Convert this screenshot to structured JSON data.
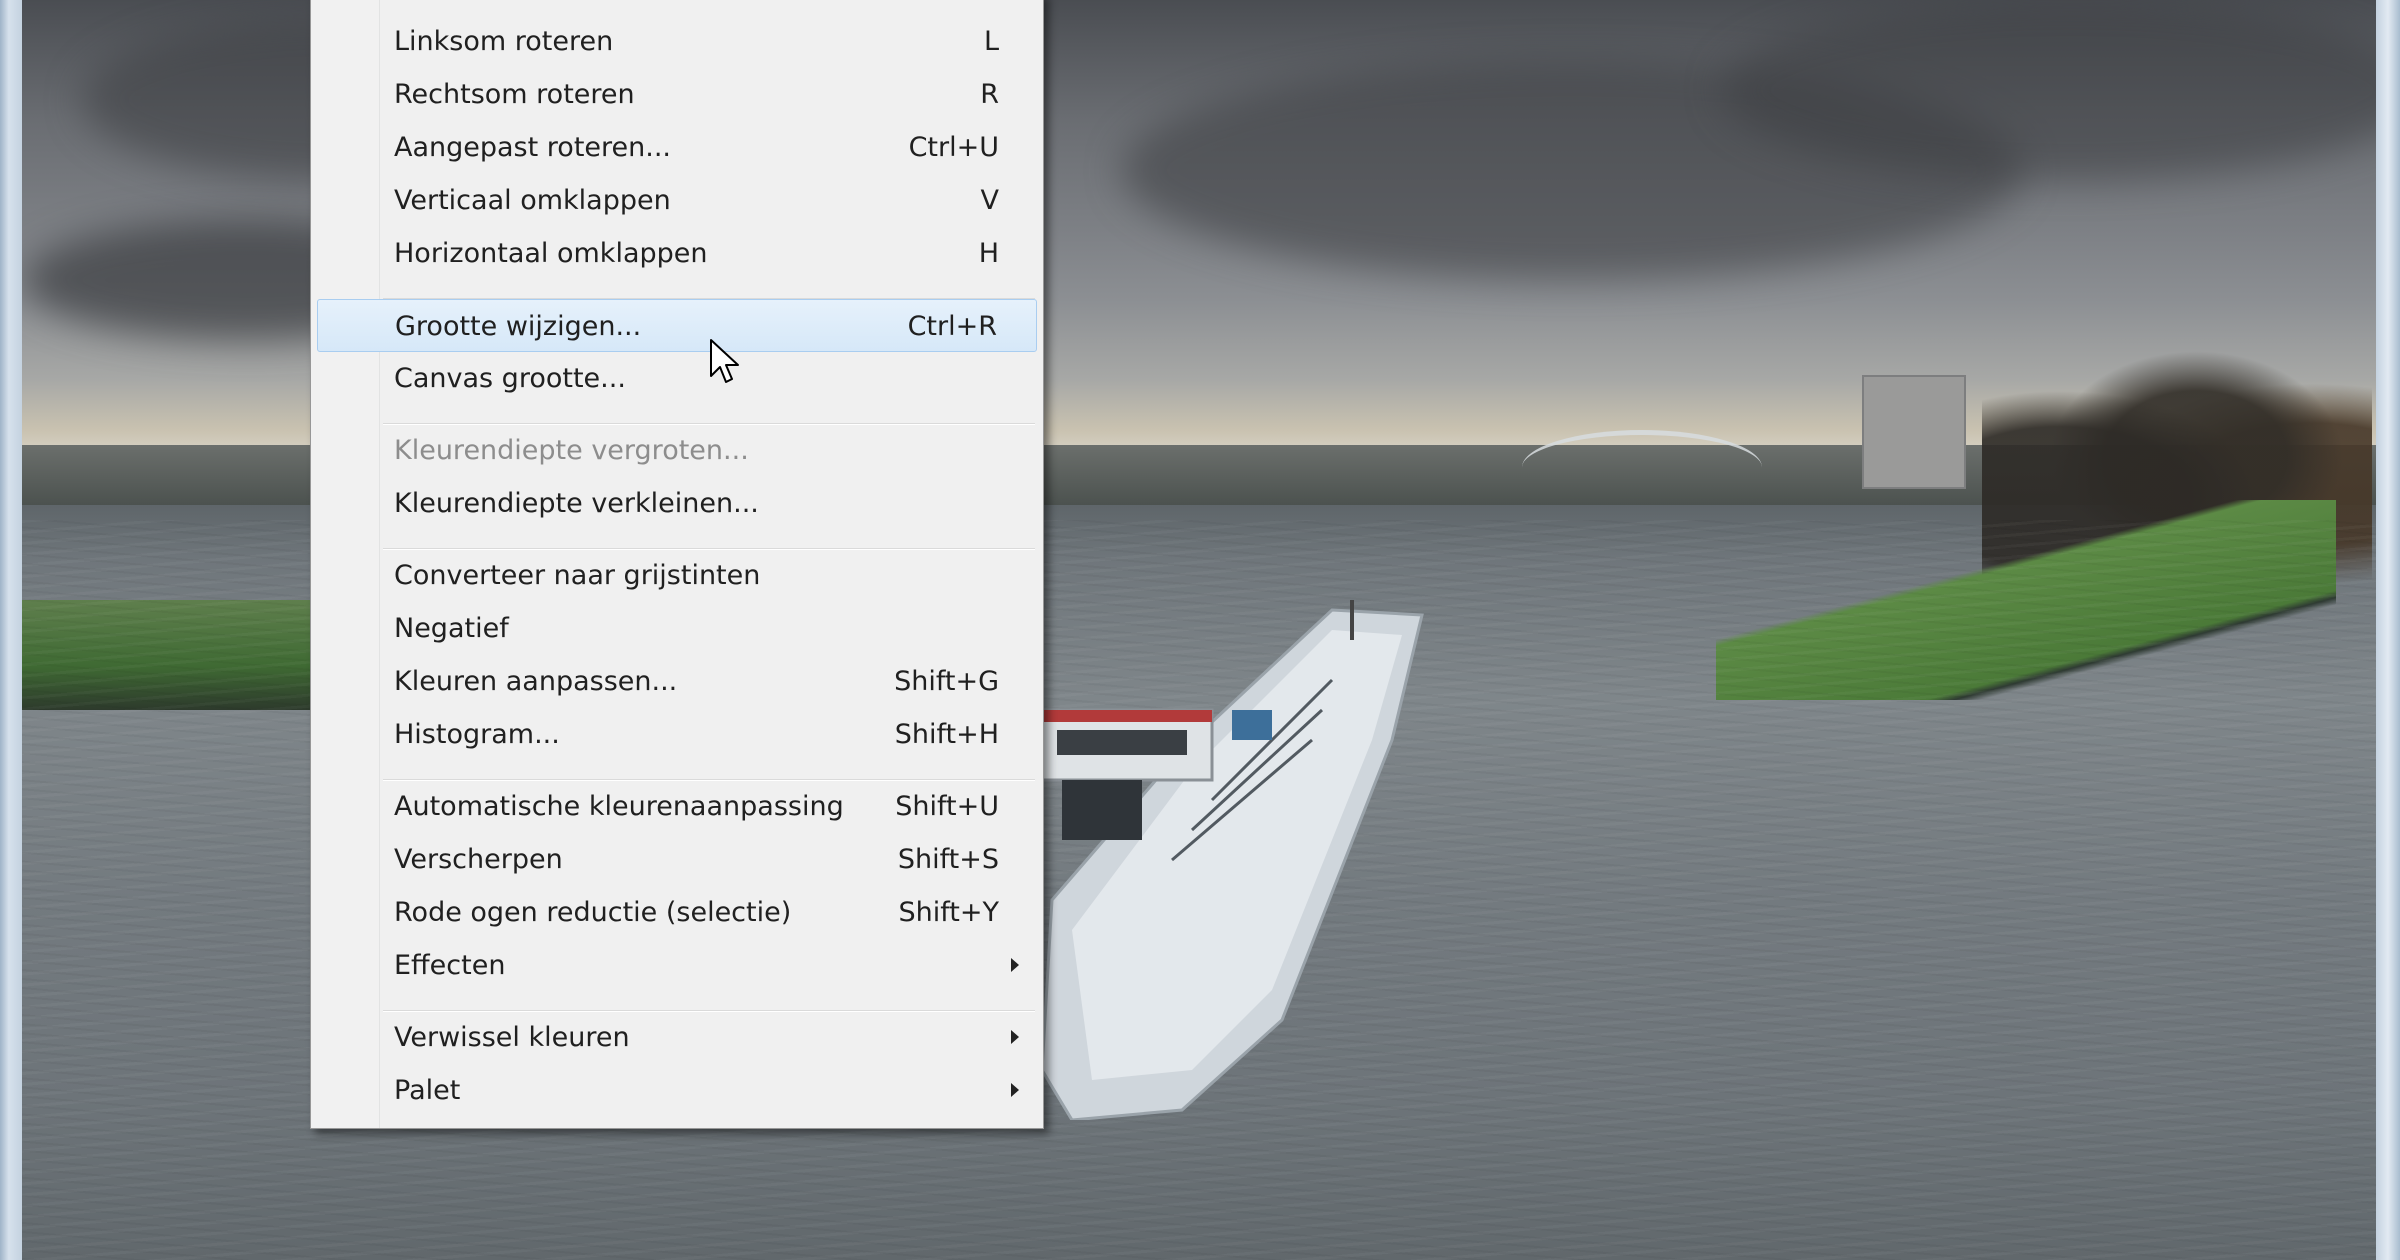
{
  "menu": {
    "items": [
      {
        "label": "Linksom roteren",
        "shortcut": "L"
      },
      {
        "label": "Rechtsom roteren",
        "shortcut": "R"
      },
      {
        "label": "Aangepast roteren...",
        "shortcut": "Ctrl+U"
      },
      {
        "label": "Verticaal omklappen",
        "shortcut": "V"
      },
      {
        "label": "Horizontaal omklappen",
        "shortcut": "H"
      },
      {
        "label": "Grootte wijzigen...",
        "shortcut": "Ctrl+R",
        "state": "highlighted"
      },
      {
        "label": "Canvas grootte...",
        "shortcut": ""
      },
      {
        "label": "Kleurendiepte vergroten...",
        "shortcut": "",
        "state": "disabled"
      },
      {
        "label": "Kleurendiepte verkleinen...",
        "shortcut": ""
      },
      {
        "label": "Converteer naar grijstinten",
        "shortcut": ""
      },
      {
        "label": "Negatief",
        "shortcut": ""
      },
      {
        "label": "Kleuren aanpassen...",
        "shortcut": "Shift+G"
      },
      {
        "label": "Histogram...",
        "shortcut": "Shift+H"
      },
      {
        "label": "Automatische kleurenaanpassing",
        "shortcut": "Shift+U"
      },
      {
        "label": "Verscherpen",
        "shortcut": "Shift+S"
      },
      {
        "label": "Rode ogen reductie (selectie)",
        "shortcut": "Shift+Y"
      },
      {
        "label": "Effecten",
        "shortcut": "",
        "submenu": true
      },
      {
        "label": "Verwissel kleuren",
        "shortcut": "",
        "submenu": true
      },
      {
        "label": "Palet",
        "shortcut": "",
        "submenu": true
      }
    ],
    "highlight_color": "#d6e8f8",
    "disabled_color": "#8d8d8d"
  },
  "icons": {
    "cursor": "arrow-cursor-icon",
    "submenu": "submenu-arrow-icon"
  }
}
